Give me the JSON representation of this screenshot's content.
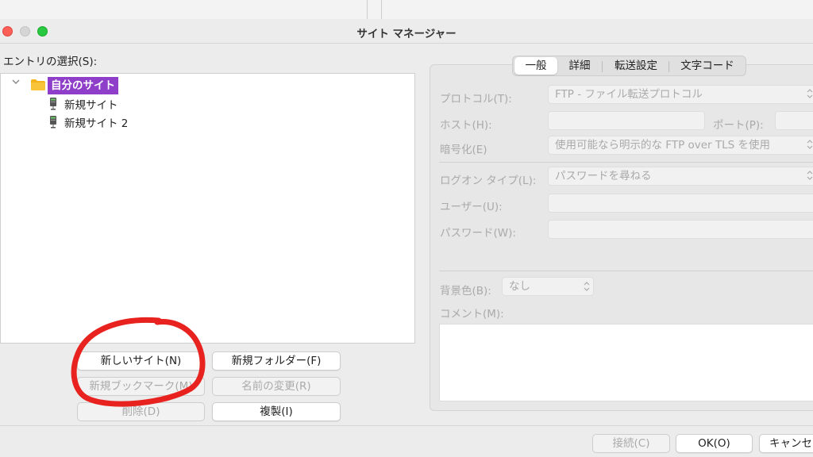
{
  "window": {
    "title": "サイト マネージャー"
  },
  "left": {
    "entry_label": "エントリの選択(S):",
    "tree": {
      "root": "自分のサイト",
      "children": [
        "新規サイト",
        "新規サイト 2"
      ]
    },
    "buttons": {
      "new_site": "新しいサイト(N)",
      "new_folder": "新規フォルダー(F)",
      "new_bookmark": "新規ブックマーク(M)",
      "rename": "名前の変更(R)",
      "delete": "削除(D)",
      "duplicate": "複製(I)"
    }
  },
  "right": {
    "tabs": [
      "一般",
      "詳細",
      "転送設定",
      "文字コード"
    ],
    "protocol_label": "プロトコル(T):",
    "protocol_value": "FTP - ファイル転送プロトコル",
    "host_label": "ホスト(H):",
    "port_label": "ポート(P):",
    "encryption_label": "暗号化(E)",
    "encryption_value": "使用可能なら明示的な FTP over TLS を使用",
    "logon_label": "ログオン タイプ(L):",
    "logon_value": "パスワードを尋ねる",
    "user_label": "ユーザー(U):",
    "password_label": "パスワード(W):",
    "bgcolor_label": "背景色(B):",
    "bgcolor_value": "なし",
    "comment_label": "コメント(M):"
  },
  "footer": {
    "connect": "接続(C)",
    "ok": "OK(O)",
    "cancel": "キャンセル"
  },
  "colors": {
    "selection": "#8e3ec9",
    "annotation": "#e8231f"
  }
}
